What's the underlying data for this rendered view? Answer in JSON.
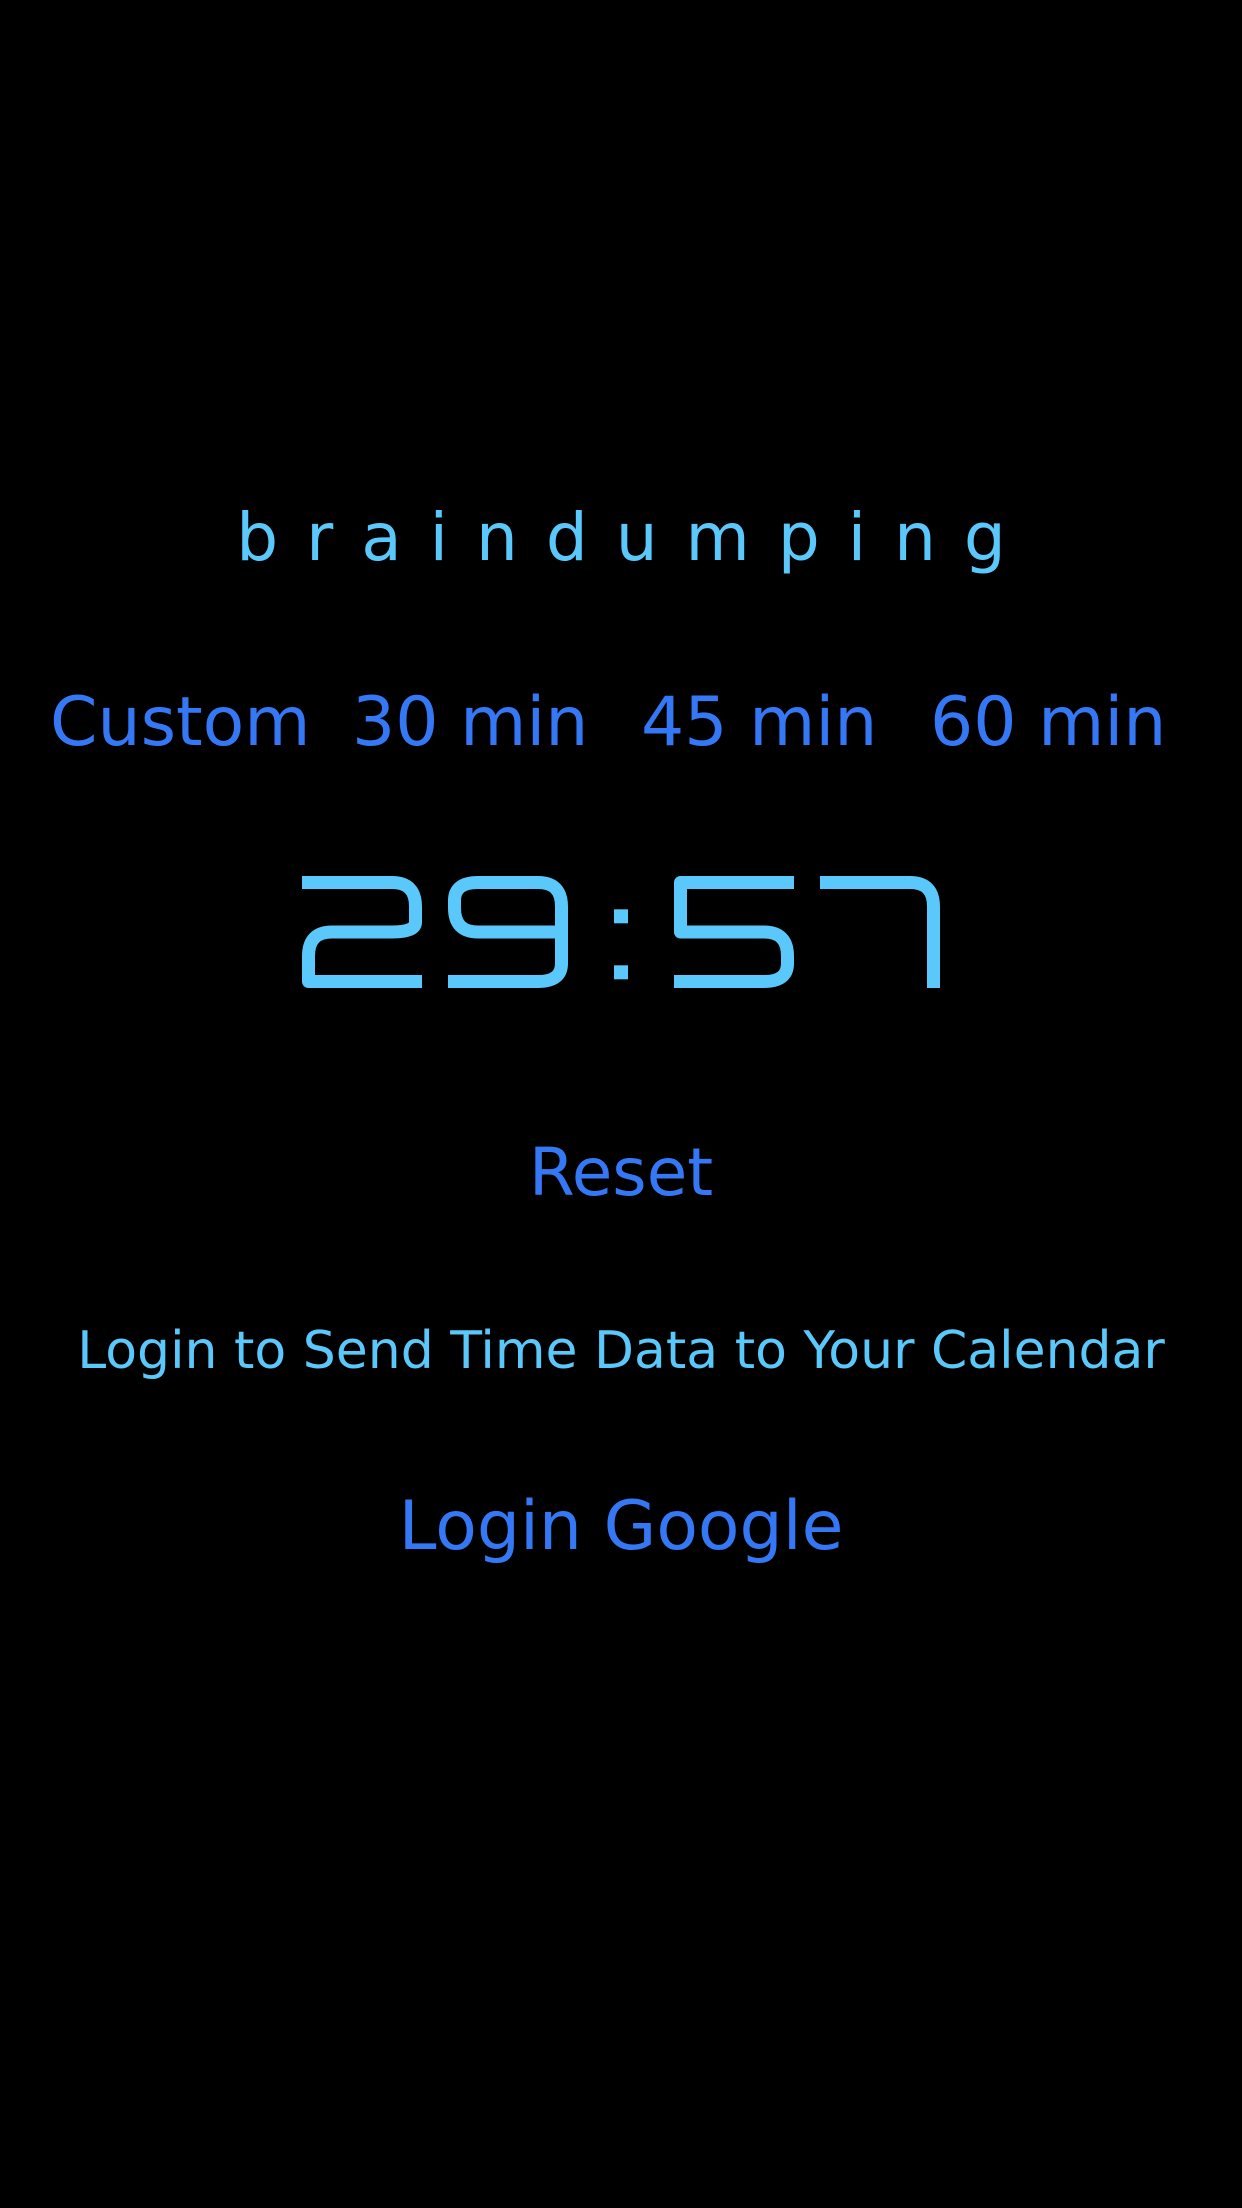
{
  "app": {
    "title": "braindumping"
  },
  "durations": {
    "custom": "Custom",
    "min30": "30 min",
    "min45": "45 min",
    "min60": "60 min"
  },
  "timer": {
    "display": "29:57"
  },
  "actions": {
    "reset": "Reset",
    "login_prompt": "Login to Send Time Data to Your Calendar",
    "login_google": "Login Google"
  },
  "colors": {
    "background": "#000000",
    "accent_light": "#5ac8fa",
    "accent_blue": "#3478f6"
  }
}
